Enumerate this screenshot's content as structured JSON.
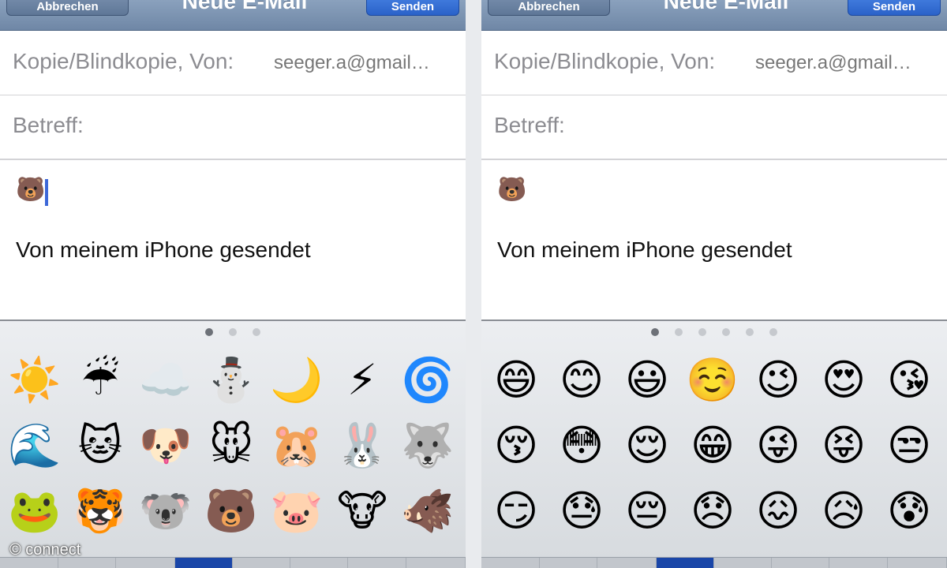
{
  "left": {
    "nav": {
      "cancel_label": "Abbrechen",
      "title": "Neue E-Mail",
      "send_label": "Senden"
    },
    "cc_label": "Kopie/Blindkopie, Von:",
    "cc_value": "seeger.a@gmail…",
    "subject_label": "Betreff:",
    "body_emoji": "🐻",
    "signature": "Von meinem iPhone gesendet",
    "page_dots": 3,
    "active_dot": 0,
    "emoji_rows": [
      [
        "☀️",
        "☔",
        "☁️",
        "⛄",
        "🌙",
        "⚡",
        "🌀"
      ],
      [
        "🌊",
        "🐱",
        "🐶",
        "🐭",
        "🐹",
        "🐰",
        "🐺"
      ],
      [
        "🐸",
        "🐯",
        "🐨",
        "🐻",
        "🐷",
        "🐮",
        "🐗"
      ]
    ]
  },
  "right": {
    "nav": {
      "cancel_label": "Abbrechen",
      "title": "Neue E-Mail",
      "send_label": "Senden"
    },
    "cc_label": "Kopie/Blindkopie, Von:",
    "cc_value": "seeger.a@gmail…",
    "subject_label": "Betreff:",
    "body_emoji": "🐻",
    "signature": "Von meinem iPhone gesendet",
    "page_dots": 6,
    "active_dot": 0,
    "emoji_rows": [
      [
        "😄",
        "😊",
        "😃",
        "☺️",
        "😉",
        "😍",
        "😘"
      ],
      [
        "😚",
        "😳",
        "😌",
        "😁",
        "😜",
        "😝",
        "😒"
      ],
      [
        "😏",
        "😓",
        "😔",
        "😞",
        "😖",
        "😥",
        "😰"
      ]
    ]
  },
  "watermark": "© connect",
  "colors": {
    "send_button": "#2a62c9",
    "cursor": "#3d68d8",
    "active_tab": "#1a46a8"
  }
}
